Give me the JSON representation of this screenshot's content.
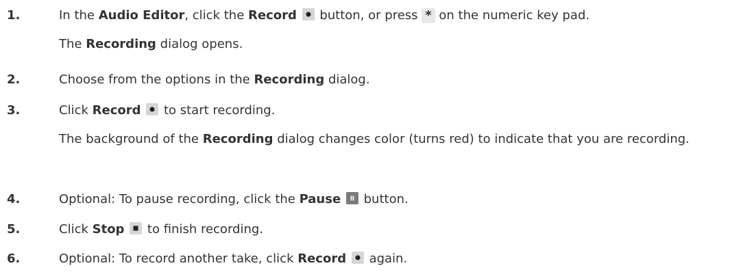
{
  "steps": [
    {
      "number": "1.",
      "instruction": {
        "t1": "In the ",
        "b1": "Audio Editor",
        "t2": ", click the ",
        "b2": "Record",
        "t3": " button, or press ",
        "key": "*",
        "t4": " on the numeric key pad."
      },
      "result": {
        "t1": "The ",
        "b1": "Recording",
        "t2": " dialog opens."
      }
    },
    {
      "number": "2.",
      "instruction": {
        "t1": "Choose from the options in the ",
        "b1": "Recording",
        "t2": " dialog."
      }
    },
    {
      "number": "3.",
      "instruction": {
        "t1": "Click ",
        "b1": "Record",
        "t2": " to start recording."
      },
      "result": {
        "t1": "The background of the ",
        "b1": "Recording",
        "t2": " dialog changes color (turns red) to indicate that you are recording."
      }
    },
    {
      "number": "4.",
      "instruction": {
        "t1": "Optional: To pause recording, click the ",
        "b1": "Pause",
        "t2": " button."
      }
    },
    {
      "number": "5.",
      "instruction": {
        "t1": "Click ",
        "b1": "Stop",
        "t2": " to finish recording."
      }
    },
    {
      "number": "6.",
      "instruction": {
        "t1": "Optional: To record another take, click ",
        "b1": "Record",
        "t2": " again."
      }
    }
  ],
  "icons": {
    "record": "record-icon",
    "stop": "stop-icon",
    "pause": "pause-icon"
  }
}
